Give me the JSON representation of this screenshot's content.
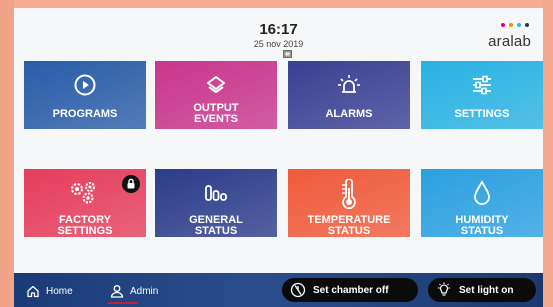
{
  "header": {
    "time": "16:17",
    "date": "25 nov 2019",
    "brand": "aralab",
    "brand_dot_colors": [
      "#e6007e",
      "#f39200",
      "#2fb8e6",
      "#1d3a70"
    ]
  },
  "tiles": [
    {
      "label_lines": [
        "PROGRAMS"
      ],
      "icon": "play-circle-icon",
      "color": "#2a5ca8"
    },
    {
      "label_lines": [
        "OUTPUT",
        "EVENTS"
      ],
      "icon": "layers-icon",
      "color": "#c8368c"
    },
    {
      "label_lines": [
        "ALARMS"
      ],
      "icon": "alarm-light-icon",
      "color": "#3a3f93"
    },
    {
      "label_lines": [
        "SETTINGS"
      ],
      "icon": "sliders-icon",
      "color": "#29b2e3"
    },
    {
      "label_lines": [
        "FACTORY",
        "SETTINGS"
      ],
      "icon": "gears-icon",
      "color": "#e53d5a",
      "locked": true
    },
    {
      "label_lines": [
        "GENERAL",
        "STATUS"
      ],
      "icon": "bar-chart-icon",
      "color": "#2b3c8a"
    },
    {
      "label_lines": [
        "TEMPERATURE",
        "STATUS"
      ],
      "icon": "thermometer-icon",
      "color": "#f05a3a"
    },
    {
      "label_lines": [
        "HUMIDITY",
        "STATUS"
      ],
      "icon": "droplet-icon",
      "color": "#2aa0e0"
    }
  ],
  "footer": {
    "home_label": "Home",
    "admin_label": "Admin",
    "chamber_off_label": "Set chamber off",
    "light_on_label": "Set light on"
  }
}
